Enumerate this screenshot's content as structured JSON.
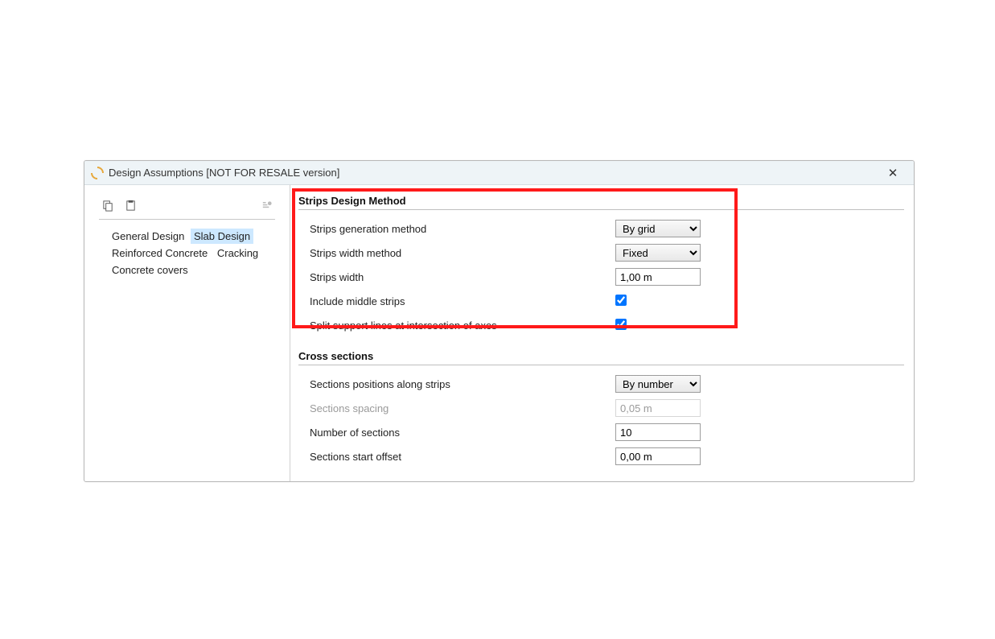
{
  "window": {
    "title": "Design Assumptions [NOT FOR RESALE version]",
    "close_glyph": "✕"
  },
  "sidebar": {
    "items": [
      {
        "label": "General Design"
      },
      {
        "label": "Slab Design"
      },
      {
        "label": "Reinforced Concrete"
      },
      {
        "label": "Cracking"
      },
      {
        "label": "Concrete covers"
      }
    ],
    "active_index": 1
  },
  "sections": {
    "strips": {
      "title": "Strips Design Method",
      "rows": {
        "gen_method": {
          "label": "Strips generation method",
          "value": "By grid",
          "options": [
            "By grid"
          ]
        },
        "width_method": {
          "label": "Strips width method",
          "value": "Fixed",
          "options": [
            "Fixed"
          ]
        },
        "strips_width": {
          "label": "Strips width",
          "value": "1,00 m"
        },
        "include_middle": {
          "label": "Include middle strips",
          "checked": true
        },
        "split_lines": {
          "label": "Split support lines at intersection of axes",
          "checked": true
        }
      }
    },
    "cross": {
      "title": "Cross sections",
      "rows": {
        "pos_along": {
          "label": "Sections positions along strips",
          "value": "By number",
          "options": [
            "By number"
          ]
        },
        "spacing": {
          "label": "Sections spacing",
          "value": "0,05 m",
          "disabled": true
        },
        "num_sections": {
          "label": "Number of sections",
          "value": "10"
        },
        "start_offset": {
          "label": "Sections start offset",
          "value": "0,00 m"
        }
      }
    }
  }
}
